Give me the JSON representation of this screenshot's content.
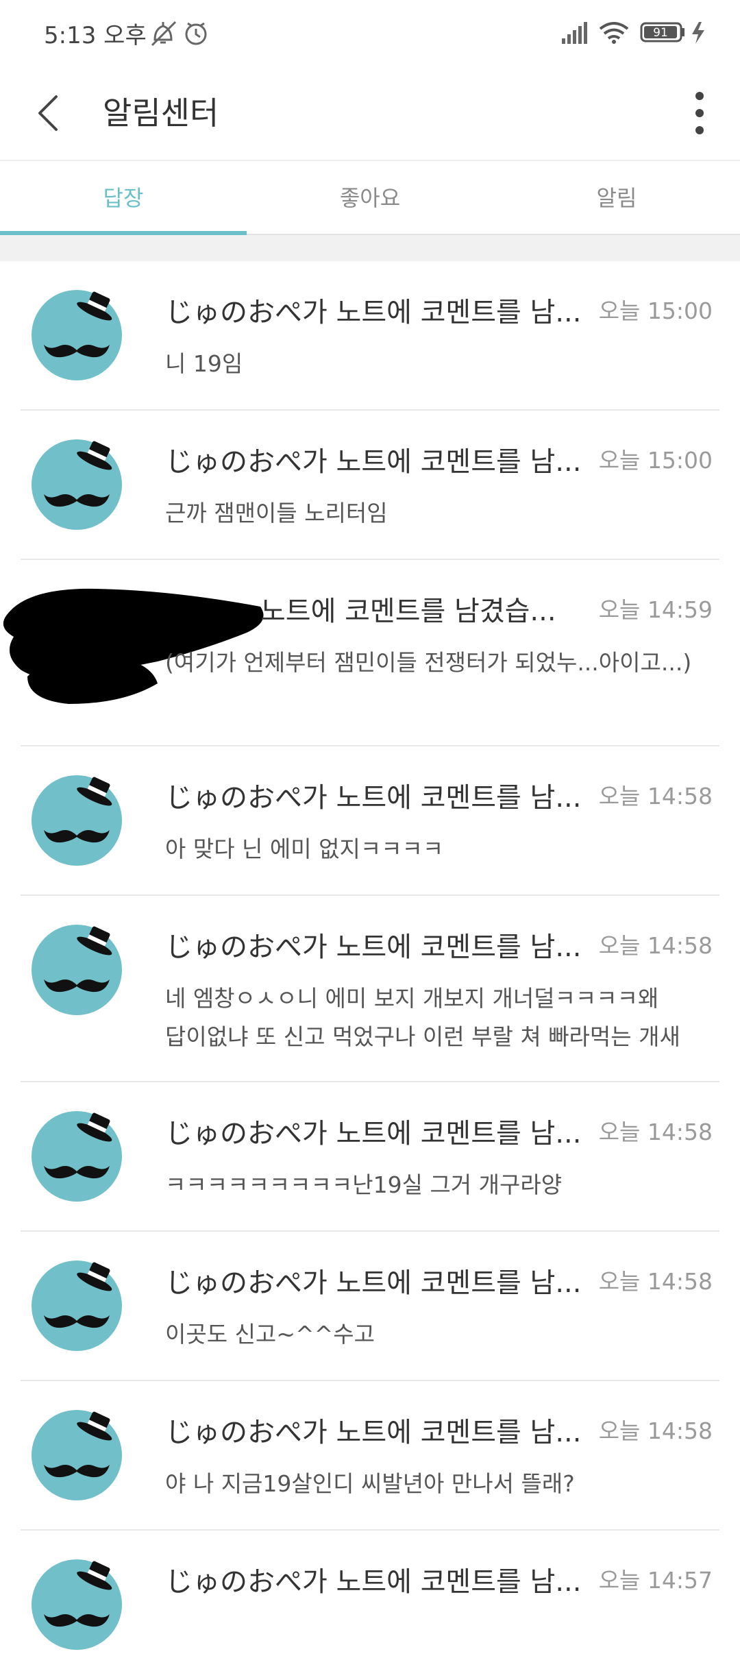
{
  "status_bar": {
    "time": "5:13 오후",
    "battery": "91"
  },
  "header": {
    "title": "알림센터",
    "back_icon": "chevron-left-icon",
    "more_icon": "more-vertical-icon"
  },
  "tabs": [
    {
      "label": "답장",
      "active": true
    },
    {
      "label": "좋아요",
      "active": false
    },
    {
      "label": "알림",
      "active": false
    }
  ],
  "colors": {
    "accent": "#6abfc8",
    "avatar": "#71bfc8"
  },
  "notifications": [
    {
      "title": "じゅのおぺ가 노트에 코멘트를 남...",
      "time": "오늘 15:00",
      "body": "니 19임"
    },
    {
      "title": "じゅのおぺ가 노트에 코멘트를 남...",
      "time": "오늘 15:00",
      "body": "근까 잼맨이들 노리터임"
    },
    {
      "title": "노트에 코멘트를 남겼습...",
      "time": "오늘 14:59",
      "body": "(여기가 언제부터 잼민이들 전쟁터가 되었누...아이고...)",
      "redacted": true
    },
    {
      "title": "じゅのおぺ가 노트에 코멘트를 남...",
      "time": "오늘 14:58",
      "body": "아 맞다 닌 에미 없지ㅋㅋㅋㅋ"
    },
    {
      "title": "じゅのおぺ가 노트에 코멘트를 남...",
      "time": "오늘 14:58",
      "body_line1": "네 엠창ㅇㅅㅇ니 에미 보지 개보지 개너덜ㅋㅋㅋㅋ왜",
      "body_line2": "답이없냐 또 신고 먹었구나 이런 부랄 쳐 빠라먹는 개새"
    },
    {
      "title": "じゅのおぺ가 노트에 코멘트를 남...",
      "time": "오늘 14:58",
      "body": "ㅋㅋㅋㅋㅋㅋㅋㅋㅋ난19실 그거 개구라양"
    },
    {
      "title": "じゅのおぺ가 노트에 코멘트를 남...",
      "time": "오늘 14:58",
      "body": "이곳도 신고~^^수고"
    },
    {
      "title": "じゅのおぺ가 노트에 코멘트를 남...",
      "time": "오늘 14:58",
      "body": "야 나 지금19살인디 씨발년아 만나서 뜰래?"
    },
    {
      "title": "じゅのおぺ가 노트에 코멘트를 남...",
      "time": "오늘 14:57",
      "body": ""
    }
  ]
}
